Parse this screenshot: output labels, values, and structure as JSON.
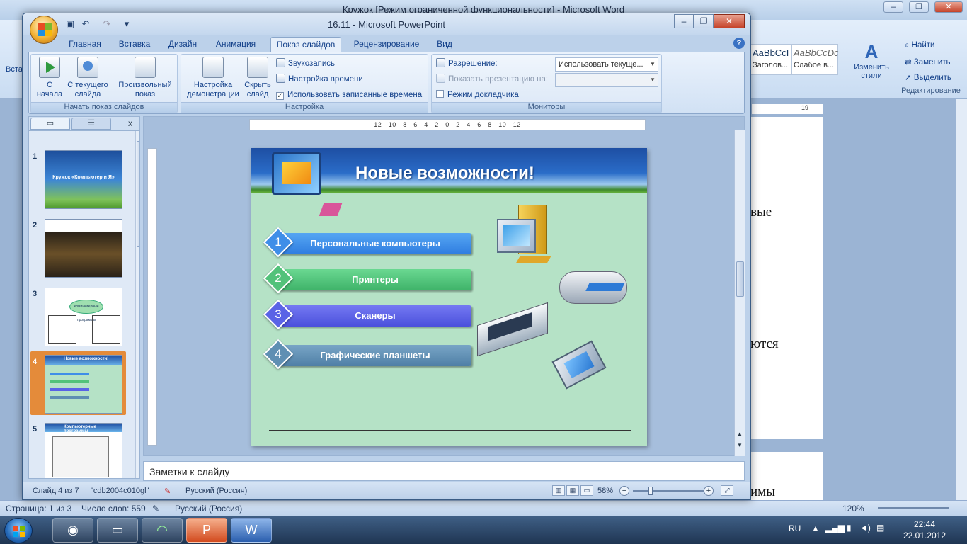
{
  "word": {
    "title": "Кружок [Режим ограниченной функциональности] - Microsoft Word",
    "ribbon": {
      "style1": "AaBbCcI",
      "style1_label": "Заголов...",
      "style2": "AaBbCcDc",
      "style2_label": "Слабое в...",
      "change_styles": "Изменить стили",
      "find": "Найти",
      "replace": "Заменить",
      "select": "Выделить",
      "group_editing": "Редактирование",
      "paste_partial": "Вста"
    },
    "ruler": "19",
    "doc_text": [
      "вые",
      "ются",
      "имы"
    ],
    "status": {
      "page": "Страница: 1 из 3",
      "words": "Число слов: 559",
      "language": "Русский (Россия)",
      "zoom": "120%"
    }
  },
  "ppt": {
    "title": "16.11 - Microsoft PowerPoint",
    "tabs": [
      "Главная",
      "Вставка",
      "Дизайн",
      "Анимация",
      "Показ слайдов",
      "Рецензирование",
      "Вид"
    ],
    "active_tab": "Показ слайдов",
    "ribbon": {
      "start_group": "Начать показ слайдов",
      "from_start": "С начала",
      "from_current": "С текущего слайда",
      "custom_show": "Произвольный показ",
      "setup_group": "Настройка",
      "setup_show": "Настройка демонстрации",
      "hide_slide": "Скрыть слайд",
      "record_narration": "Звукозапись",
      "rehearse": "Настройка времени",
      "use_timings": "Использовать записанные времена",
      "monitors_group": "Мониторы",
      "resolution_label": "Разрешение:",
      "resolution_value": "Использовать текуще...",
      "show_on_label": "Показать презентацию на:",
      "show_on_value": "",
      "presenter_view": "Режим докладчика"
    },
    "thumbs": [
      {
        "num": "1",
        "text": "Кружок «Компьютер и Я»"
      },
      {
        "num": "2",
        "text": ""
      },
      {
        "num": "3",
        "text": "Компьютерные программы"
      },
      {
        "num": "4",
        "text": "Новые возможности!"
      },
      {
        "num": "5",
        "text": "Компьютерные программы"
      }
    ],
    "ruler_text": "12 · 10 · 8 · 6 · 4 · 2 · 0 · 2 · 4 · 6 · 8 · 10 · 12",
    "slide": {
      "title": "Новые возможности!",
      "items": [
        {
          "num": "1",
          "label": "Персональные компьютеры",
          "color": "#3f8ee8"
        },
        {
          "num": "2",
          "label": "Принтеры",
          "color": "#52c27a"
        },
        {
          "num": "3",
          "label": "Сканеры",
          "color": "#5a63e6"
        },
        {
          "num": "4",
          "label": "Графические планшеты",
          "color": "#5f8fb3"
        }
      ]
    },
    "notes_placeholder": "Заметки к слайду",
    "status": {
      "slide": "Слайд 4 из 7",
      "theme": "\"cdb2004c010gl\"",
      "language": "Русский (Россия)",
      "zoom": "58%"
    }
  },
  "taskbar": {
    "lang": "RU",
    "time": "22:44",
    "date": "22.01.2012"
  }
}
